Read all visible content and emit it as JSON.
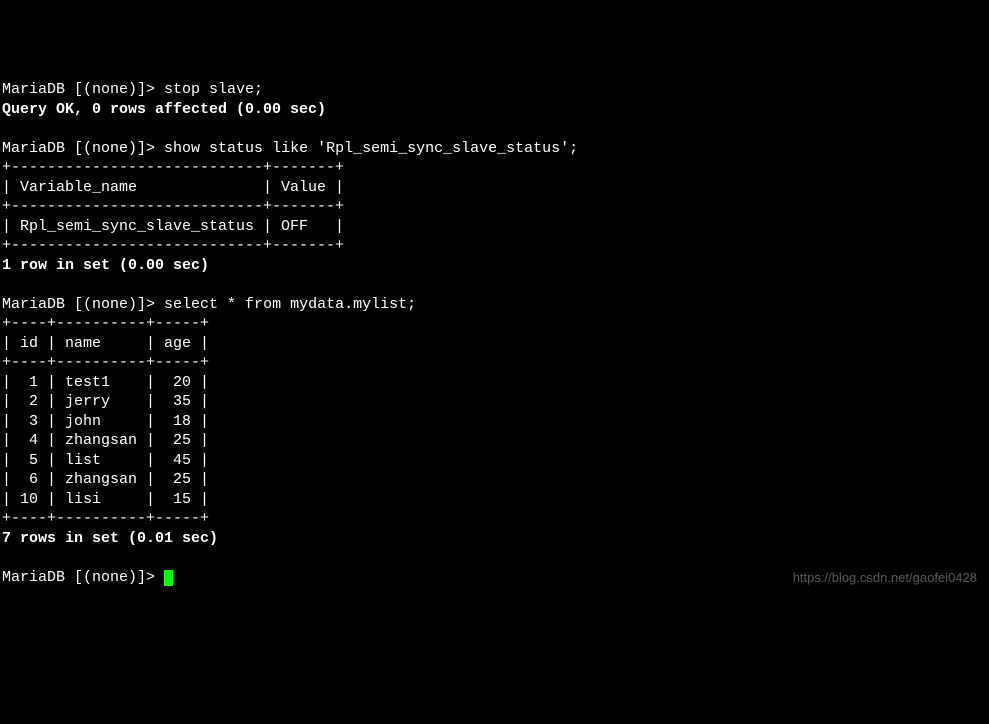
{
  "prompt": "MariaDB [(none)]>",
  "cmd1": "stop slave;",
  "result1": "Query OK, 0 rows affected (0.00 sec)",
  "cmd2": "show status like 'Rpl_semi_sync_slave_status';",
  "table1": {
    "border": "+----------------------------+-------+",
    "header": "| Variable_name              | Value |",
    "row": "| Rpl_semi_sync_slave_status | OFF   |"
  },
  "result2": "1 row in set (0.00 sec)",
  "cmd3": "select * from mydata.mylist;",
  "table2": {
    "border": "+----+----------+-----+",
    "header": "| id | name     | age |",
    "rows": [
      "|  1 | test1    |  20 |",
      "|  2 | jerry    |  35 |",
      "|  3 | john     |  18 |",
      "|  4 | zhangsan |  25 |",
      "|  5 | list     |  45 |",
      "|  6 | zhangsan |  25 |",
      "| 10 | lisi     |  15 |"
    ]
  },
  "result3": "7 rows in set (0.01 sec)",
  "watermark": "https://blog.csdn.net/gaofei0428",
  "chart_data": {
    "type": "table",
    "tables": [
      {
        "columns": [
          "Variable_name",
          "Value"
        ],
        "rows": [
          [
            "Rpl_semi_sync_slave_status",
            "OFF"
          ]
        ]
      },
      {
        "columns": [
          "id",
          "name",
          "age"
        ],
        "rows": [
          [
            1,
            "test1",
            20
          ],
          [
            2,
            "jerry",
            35
          ],
          [
            3,
            "john",
            18
          ],
          [
            4,
            "zhangsan",
            25
          ],
          [
            5,
            "list",
            45
          ],
          [
            6,
            "zhangsan",
            25
          ],
          [
            10,
            "lisi",
            15
          ]
        ]
      }
    ]
  }
}
